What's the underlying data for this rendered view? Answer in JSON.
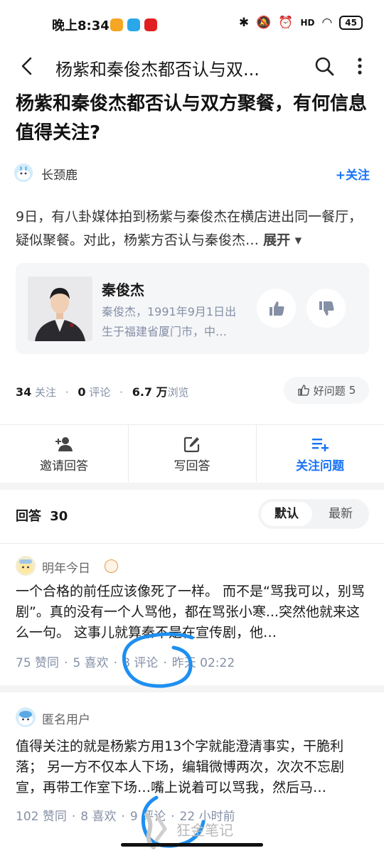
{
  "status_bar": {
    "time": "晚上8:34",
    "battery": "45",
    "network": "HD"
  },
  "nav": {
    "title": "杨紫和秦俊杰都否认与双..."
  },
  "question": {
    "title": "杨紫和秦俊杰都否认与双方聚餐，有何信息值得关注?",
    "asker": "长颈鹿",
    "follow_label": "+关注",
    "description": "9日，有八卦媒体拍到杨紫与秦俊杰在横店进出同一餐厅，疑似聚餐。对此，杨紫方否认与秦俊杰…",
    "expand_label": "展开 ▾"
  },
  "topic_card": {
    "name": "秦俊杰",
    "description": "秦俊杰，1991年9月1日出生于福建省厦门市，中…"
  },
  "stats": {
    "follows": "34",
    "follows_label": "关注",
    "comments": "0",
    "comments_label": "评论",
    "views": "6.7 万",
    "views_label": "浏览",
    "good_question_label": "好问题",
    "good_question_count": "5"
  },
  "actions": {
    "invite": "邀请回答",
    "write": "写回答",
    "follow_question": "关注问题"
  },
  "answers_header": {
    "label": "回答",
    "count": "30",
    "sort_default": "默认",
    "sort_latest": "最新"
  },
  "answers": [
    {
      "author": "明年今日",
      "text": "一个合格的前任应该像死了一样。 而不是“骂我可以，别骂剧”。真的没有一个人骂他，都在骂张小寒...突然他就来这么一句。 这事儿就算秦不是在宣传剧，他…",
      "likes": "75 赞同",
      "favs": "5 喜欢",
      "comments": "8 评论",
      "time": "昨天 02:22"
    },
    {
      "author": "匿名用户",
      "text": "值得关注的就是杨紫方用13个字就能澄清事实，干脆利落； 另一方不仅本人下场，编辑微博两次，次次不忘剧宣，再带工作室下场…嘴上说着可以骂我，然后马…",
      "likes": "102 赞同",
      "favs": "8 喜欢",
      "comments": "9 评论",
      "time": "22 小时前"
    }
  ],
  "watermark": {
    "text": "狂金笔记"
  },
  "colors": {
    "accent": "#1772f6",
    "muted": "#8590a6",
    "annotation": "#1e8ff0"
  }
}
